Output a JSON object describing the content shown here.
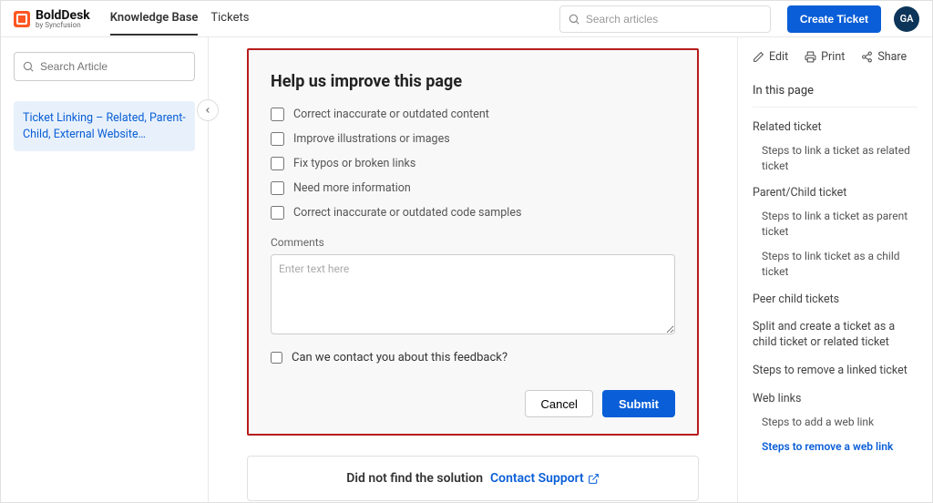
{
  "header": {
    "brand_main": "BoldDesk",
    "brand_sub": "by Syncfusion",
    "tabs": {
      "kb": "Knowledge Base",
      "tickets": "Tickets"
    },
    "search_placeholder": "Search articles",
    "create_label": "Create Ticket",
    "avatar_initials": "GA"
  },
  "left": {
    "search_placeholder": "Search Article",
    "article_title": "Ticket Linking – Related, Parent-Child, External Website…"
  },
  "feedback": {
    "title": "Help us improve this page",
    "options": {
      "o0": "Correct inaccurate or outdated content",
      "o1": "Improve illustrations or images",
      "o2": "Fix typos or broken links",
      "o3": "Need more information",
      "o4": "Correct inaccurate or outdated code samples"
    },
    "comments_label": "Comments",
    "comments_placeholder": "Enter text here",
    "contact_label": "Can we contact you about this feedback?",
    "cancel": "Cancel",
    "submit": "Submit"
  },
  "support": {
    "lead": "Did not find the solution",
    "link": "Contact Support"
  },
  "right": {
    "edit": "Edit",
    "print": "Print",
    "share": "Share",
    "section_title": "In this page",
    "toc": {
      "t0": "Related ticket",
      "t0a": "Steps to link a ticket as related ticket",
      "t1": "Parent/Child ticket",
      "t1a": "Steps to link a ticket as parent ticket",
      "t1b": "Steps to link ticket as a child ticket",
      "t2": "Peer child tickets",
      "t3": "Split and create a ticket as a child ticket or related ticket",
      "t4": "Steps to remove a linked ticket",
      "t5": "Web links",
      "t5a": "Steps to add a web link",
      "t5b": "Steps to remove a web link"
    }
  }
}
